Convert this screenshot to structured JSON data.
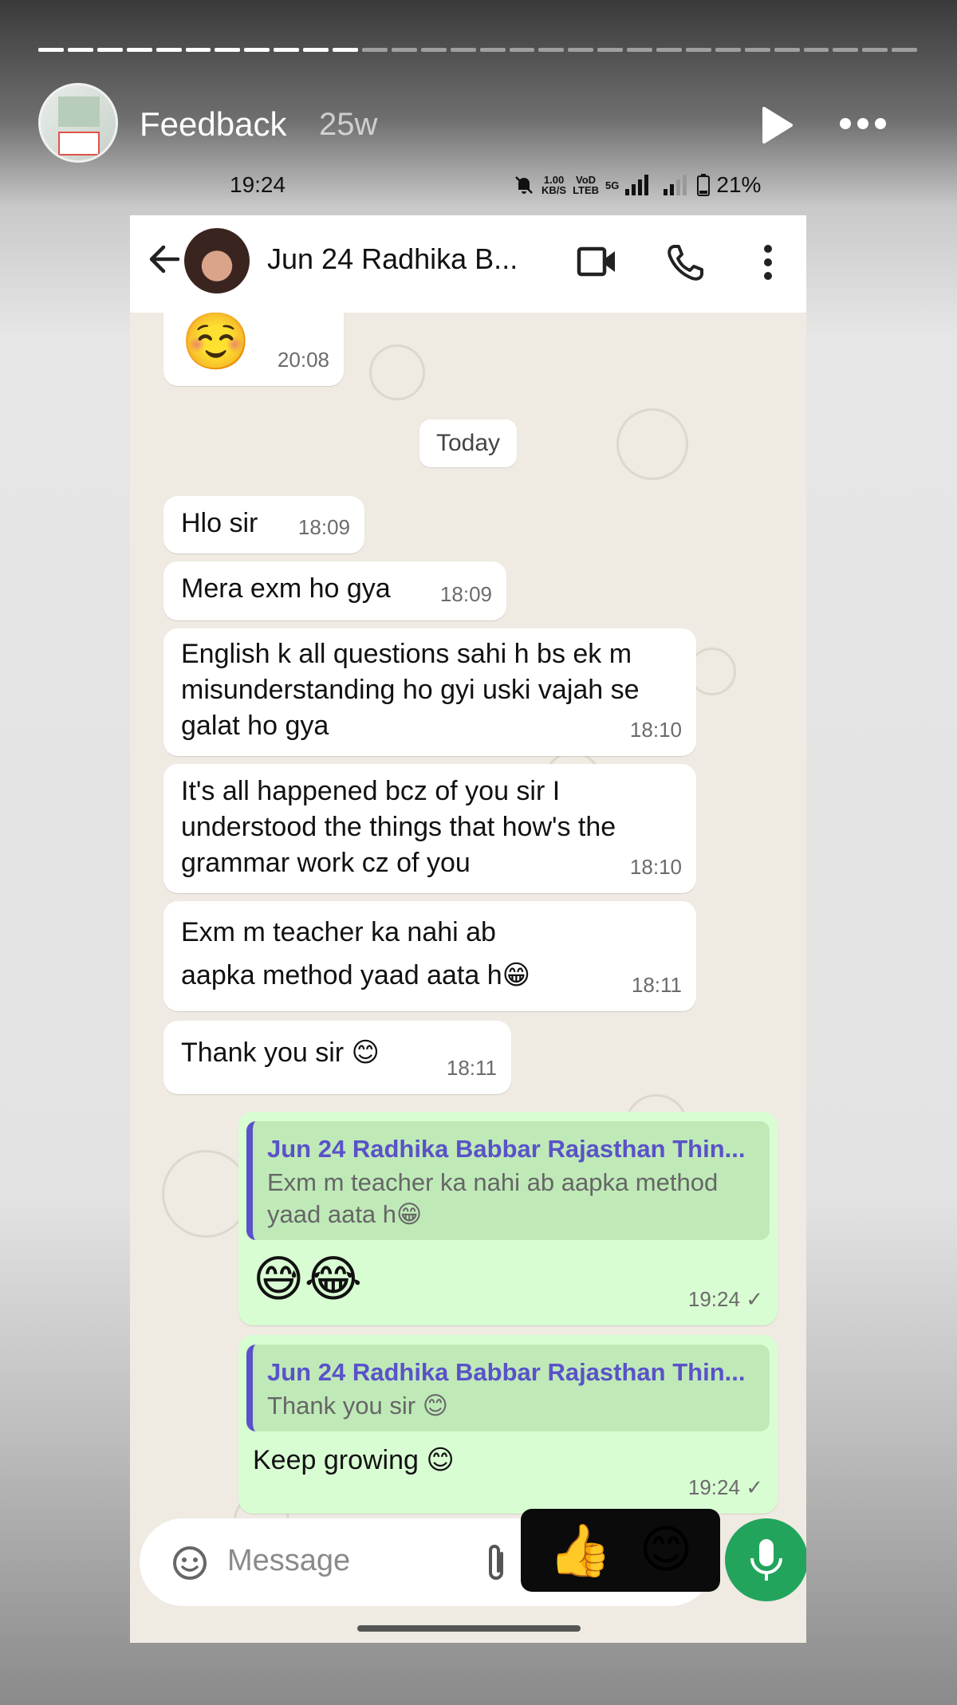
{
  "story": {
    "title": "Feedback",
    "age": "25w",
    "progress_segments_total": 30,
    "progress_segments_done": 11
  },
  "status_bar": {
    "time": "19:24",
    "speed": "1.00",
    "speed_unit": "KB/S",
    "volte": "VoD",
    "lte": "LTEB",
    "network": "5G",
    "battery": "21%"
  },
  "chat_header": {
    "contact_name": "Jun 24 Radhika B..."
  },
  "messages": [
    {
      "dir": "in",
      "text": "☺️",
      "time": "20:08"
    },
    {
      "dir": "chip",
      "text": "Today"
    },
    {
      "dir": "in",
      "text": "Hlo sir",
      "time": "18:09"
    },
    {
      "dir": "in",
      "text": "Mera exm ho gya",
      "time": "18:09"
    },
    {
      "dir": "in",
      "text": "English k all questions sahi h bs ek m misunderstanding ho gyi uski vajah se galat ho gya",
      "time": "18:10"
    },
    {
      "dir": "in",
      "text": "It's all happened bcz of you sir I understood the things that how's the grammar work cz of you",
      "time": "18:10"
    },
    {
      "dir": "in",
      "text": "Exm m teacher ka nahi ab aapka method yaad aata h😁",
      "time": "18:11"
    },
    {
      "dir": "in",
      "text": "Thank you sir 😊",
      "time": "18:11"
    },
    {
      "dir": "out",
      "quote_author": "Jun 24 Radhika Babbar Rajasthan Thin...",
      "quote_text": "Exm m teacher ka nahi ab aapka method yaad aata h😁",
      "text": "😅😂",
      "time": "19:24",
      "tick": "✓"
    },
    {
      "dir": "out",
      "quote_author": "Jun 24 Radhika Babbar Rajasthan Thin...",
      "quote_text": "Thank you sir 😊",
      "text": "Keep growing 😊",
      "time": "19:24",
      "tick": "✓"
    }
  ],
  "input": {
    "placeholder": "Message"
  },
  "quick_reactions": [
    "👍",
    "😊"
  ],
  "colors": {
    "incoming_bubble": "#ffffff",
    "outgoing_bubble": "#d9fdd3",
    "chat_background": "#efeae2",
    "quote_accent": "#5a52c8",
    "mic_button": "#22a45d"
  }
}
